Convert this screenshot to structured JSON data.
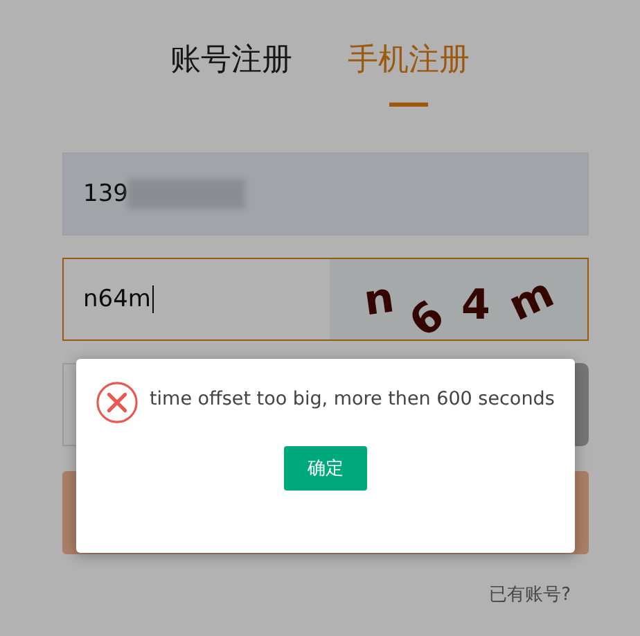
{
  "tabs": [
    {
      "label": "账号注册",
      "selected": false
    },
    {
      "label": "手机注册",
      "selected": true
    }
  ],
  "phone_field": {
    "value": "139",
    "redacted": true
  },
  "captcha_field": {
    "value": "n64m",
    "focused": true,
    "captcha_chars": [
      "n",
      "6",
      "4",
      "m"
    ]
  },
  "sms_row": {
    "disabled": true
  },
  "login_link": "已有账号?",
  "dialog": {
    "kind": "error",
    "message": "time offset too big, more then 600 seconds",
    "button": "确定"
  }
}
